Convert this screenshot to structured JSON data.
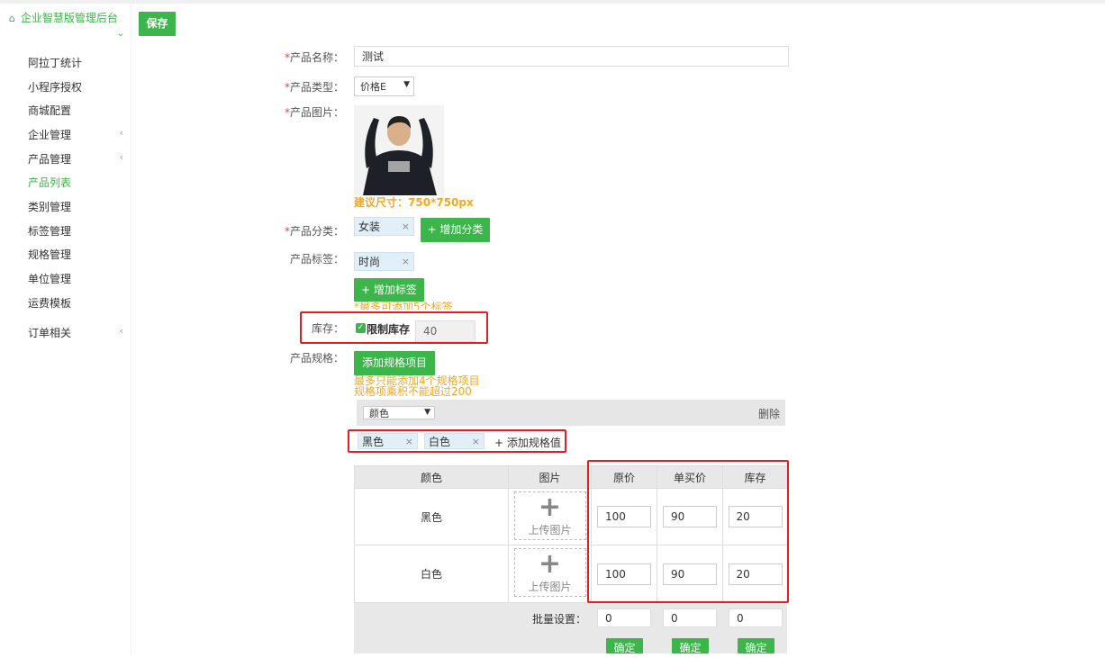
{
  "sidebar": {
    "brand": "企业智慧版管理后台",
    "items": [
      {
        "label": "阿拉丁统计",
        "caret": ""
      },
      {
        "label": "小程序授权",
        "caret": ""
      },
      {
        "label": "商城配置",
        "caret": ""
      },
      {
        "label": "企业管理",
        "caret": "‹"
      },
      {
        "label": "产品管理",
        "caret": "‹"
      },
      {
        "label": "产品列表",
        "caret": ""
      },
      {
        "label": "类别管理",
        "caret": ""
      },
      {
        "label": "标签管理",
        "caret": ""
      },
      {
        "label": "规格管理",
        "caret": ""
      },
      {
        "label": "单位管理",
        "caret": ""
      },
      {
        "label": "运费模板",
        "caret": ""
      },
      {
        "label": "订单相关",
        "caret": "‹"
      }
    ],
    "active_index": 5
  },
  "toolbar": {
    "save_label": "保存"
  },
  "form": {
    "name_label": "产品名称：",
    "name_value": "测试",
    "type_label": "产品类型：",
    "type_value": "价格E",
    "image_label": "产品图片：",
    "image_hint": "建议尺寸：750*750px",
    "category_label": "产品分类：",
    "category_tag": "女装",
    "add_category": "+ 增加分类",
    "tag_label": "产品标签：",
    "tag_value": "时尚",
    "add_tag": "+ 增加标签",
    "tag_hint": "*最多可添加5个标签",
    "stock_label": "库存：",
    "stock_check_label": "限制库存",
    "stock_value": "40",
    "spec_label": "产品规格：",
    "add_spec_item": "添加规格项目",
    "spec_hint_1": "最多只能添加4个规格项目",
    "spec_hint_2": "规格项乘积不能超过200",
    "spec_select": "颜色",
    "spec_delete": "删除",
    "spec_values": [
      "黑色",
      "白色"
    ],
    "add_spec_value": "+ 添加规格值"
  },
  "table": {
    "headers": [
      "颜色",
      "图片",
      "原价",
      "单买价",
      "库存"
    ],
    "upload_text": "上传图片",
    "rows": [
      {
        "color": "黑色",
        "price": "100",
        "single": "90",
        "stock": "20"
      },
      {
        "color": "白色",
        "price": "100",
        "single": "90",
        "stock": "20"
      }
    ],
    "batch_label": "批量设置：",
    "batch_values": [
      "0",
      "0",
      "0"
    ],
    "confirm_label": "确定"
  },
  "colors": {
    "accent": "#3cb54a",
    "warning": "#f5a623",
    "highlight": "#e02020"
  }
}
